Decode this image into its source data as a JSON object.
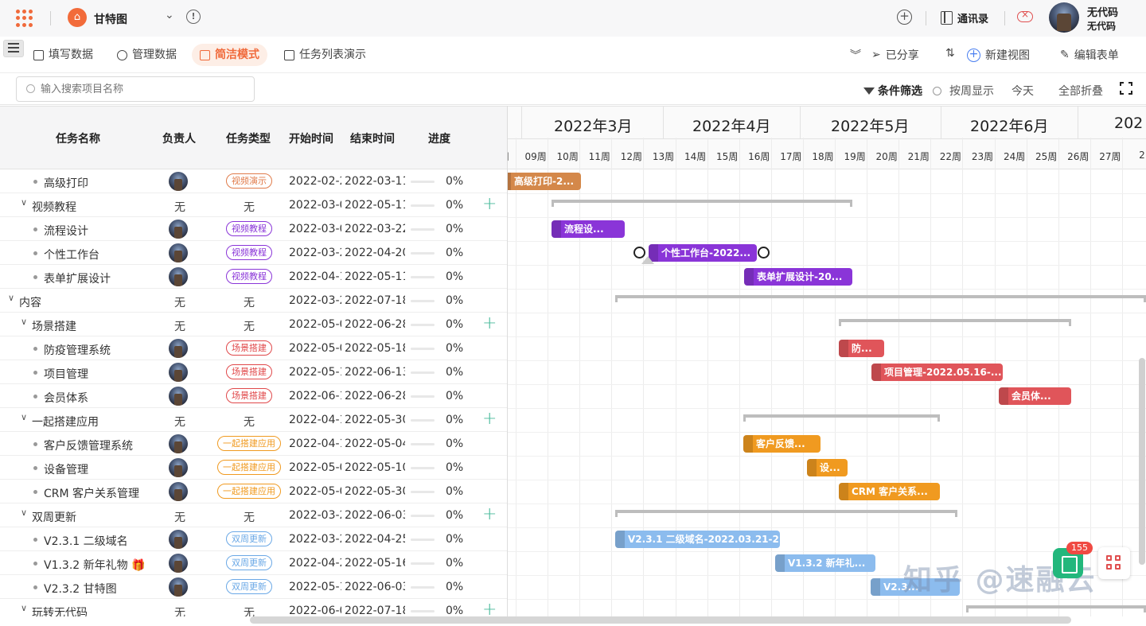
{
  "app": {
    "title": "甘特图",
    "logo_icon": "home-icon",
    "accent": "#f06a3b"
  },
  "header": {
    "contacts_label": "通讯录",
    "user_name": "无代码",
    "user_sub": "无代码"
  },
  "toolbar": {
    "tabs": [
      {
        "label": "填写数据",
        "icon": "form-icon"
      },
      {
        "label": "管理数据",
        "icon": "gear-icon"
      },
      {
        "label": "简洁模式",
        "icon": "gantt-icon",
        "active": true
      },
      {
        "label": "任务列表演示",
        "icon": "list-icon"
      }
    ],
    "shared_label": "已分享",
    "new_view_label": "新建视图",
    "edit_form_label": "编辑表单"
  },
  "search": {
    "placeholder": "输入搜索项目名称"
  },
  "controls": {
    "filter_label": "条件筛选",
    "week_label": "按周显示",
    "today_label": "今天",
    "collapse_label": "全部折叠"
  },
  "table": {
    "columns": [
      "任务名称",
      "负责人",
      "任务类型",
      "开始时间",
      "结束时间",
      "进度"
    ],
    "rows": [
      {
        "level": 2,
        "name": "高级打印",
        "owner": "avatar",
        "type": "视频演示",
        "start": "2022-02-2",
        "end": "2022-03-11",
        "progress": "0%",
        "tag_color": "#e07b4a"
      },
      {
        "level": 1,
        "name": "视频教程",
        "owner": "无",
        "type": "无",
        "start": "2022-03-0",
        "end": "2022-05-11",
        "progress": "0%",
        "add": true
      },
      {
        "level": 2,
        "name": "流程设计",
        "owner": "avatar",
        "type": "视频教程",
        "start": "2022-03-0",
        "end": "2022-03-22",
        "progress": "0%",
        "tag_color": "#8a35d8"
      },
      {
        "level": 2,
        "name": "个性工作台",
        "owner": "avatar",
        "type": "视频教程",
        "start": "2022-03-2",
        "end": "2022-04-20",
        "progress": "0%",
        "tag_color": "#8a35d8"
      },
      {
        "level": 2,
        "name": "表单扩展设计",
        "owner": "avatar",
        "type": "视频教程",
        "start": "2022-04-1",
        "end": "2022-05-11",
        "progress": "0%",
        "tag_color": "#8a35d8"
      },
      {
        "level": 0,
        "name": "内容",
        "owner": "无",
        "type": "无",
        "start": "2022-03-2",
        "end": "2022-07-18",
        "progress": "0%"
      },
      {
        "level": 1,
        "name": "场景搭建",
        "owner": "无",
        "type": "无",
        "start": "2022-05-0",
        "end": "2022-06-28",
        "progress": "0%",
        "add": true
      },
      {
        "level": 2,
        "name": "防疫管理系统",
        "owner": "avatar",
        "type": "场景搭建",
        "start": "2022-05-0",
        "end": "2022-05-18",
        "progress": "0%",
        "tag_color": "#e0484a"
      },
      {
        "level": 2,
        "name": "项目管理",
        "owner": "avatar",
        "type": "场景搭建",
        "start": "2022-05-1",
        "end": "2022-06-13",
        "progress": "0%",
        "tag_color": "#e0484a"
      },
      {
        "level": 2,
        "name": "会员体系",
        "owner": "avatar",
        "type": "场景搭建",
        "start": "2022-06-1",
        "end": "2022-06-28",
        "progress": "0%",
        "tag_color": "#e0484a"
      },
      {
        "level": 1,
        "name": "一起搭建应用",
        "owner": "无",
        "type": "无",
        "start": "2022-04-1",
        "end": "2022-05-30",
        "progress": "0%",
        "add": true
      },
      {
        "level": 2,
        "name": "客户反馈管理系统",
        "owner": "avatar",
        "type": "一起搭建应用",
        "start": "2022-04-1",
        "end": "2022-05-04",
        "progress": "0%",
        "tag_color": "#f09a20"
      },
      {
        "level": 2,
        "name": "设备管理",
        "owner": "avatar",
        "type": "一起搭建应用",
        "start": "2022-05-0",
        "end": "2022-05-10",
        "progress": "0%",
        "tag_color": "#f09a20"
      },
      {
        "level": 2,
        "name": "CRM 客户关系管理",
        "owner": "avatar",
        "type": "一起搭建应用",
        "start": "2022-05-0",
        "end": "2022-05-30",
        "progress": "0%",
        "tag_color": "#f09a20"
      },
      {
        "level": 1,
        "name": "双周更新",
        "owner": "无",
        "type": "无",
        "start": "2022-03-2",
        "end": "2022-06-03",
        "progress": "0%",
        "add": true
      },
      {
        "level": 2,
        "name": "V2.3.1 二级域名",
        "owner": "avatar",
        "type": "双周更新",
        "start": "2022-03-2",
        "end": "2022-04-25",
        "progress": "0%",
        "tag_color": "#6aa8e6"
      },
      {
        "level": 2,
        "name": "V1.3.2 新年礼物 🎁",
        "owner": "avatar",
        "type": "双周更新",
        "start": "2022-04-2",
        "end": "2022-05-16",
        "progress": "0%",
        "tag_color": "#6aa8e6"
      },
      {
        "level": 2,
        "name": "V2.3.2 甘特图",
        "owner": "avatar",
        "type": "双周更新",
        "start": "2022-05-1",
        "end": "2022-06-03",
        "progress": "0%",
        "tag_color": "#6aa8e6"
      },
      {
        "level": 1,
        "name": "玩转无代码",
        "owner": "无",
        "type": "无",
        "start": "2022-06-0",
        "end": "2022-07-18",
        "progress": "0%",
        "add": true
      }
    ]
  },
  "gantt": {
    "months": [
      "2022年3月",
      "2022年4月",
      "2022年5月",
      "2022年6月",
      "202"
    ],
    "weeks": [
      "周",
      "09周",
      "10周",
      "11周",
      "12周",
      "13周",
      "14周",
      "15周",
      "16周",
      "17周",
      "18周",
      "19周",
      "20周",
      "21周",
      "22周",
      "23周",
      "24周",
      "25周",
      "26周",
      "27周",
      "2"
    ],
    "bars": [
      {
        "row": 0,
        "label": "高级打印-2...",
        "color": "#d4884a"
      },
      {
        "row": 2,
        "label": "流程设...",
        "color": "#8a35d8"
      },
      {
        "row": 3,
        "label": "个性工作台-2022...",
        "color": "#8a35d8"
      },
      {
        "row": 4,
        "label": "表单扩展设计-20...",
        "color": "#8a35d8"
      },
      {
        "row": 7,
        "label": "防...",
        "color": "#e0555a"
      },
      {
        "row": 8,
        "label": "项目管理-2022.05.16-...",
        "color": "#e0555a"
      },
      {
        "row": 9,
        "label": "会员体...",
        "color": "#e0555a"
      },
      {
        "row": 11,
        "label": "客户反馈...",
        "color": "#f09a20"
      },
      {
        "row": 12,
        "label": "设...",
        "color": "#f09a20"
      },
      {
        "row": 13,
        "label": "CRM 客户关系...",
        "color": "#f09a20"
      },
      {
        "row": 15,
        "label": "V2.3.1 二级域名-2022.03.21-2...",
        "color": "#8cbcee"
      },
      {
        "row": 16,
        "label": "V1.3.2 新年礼...",
        "color": "#8cbcee"
      },
      {
        "row": 17,
        "label": "V2.3...",
        "color": "#8cbcee"
      }
    ]
  },
  "widget": {
    "badge": "155"
  },
  "watermark": "知乎 @速融云"
}
